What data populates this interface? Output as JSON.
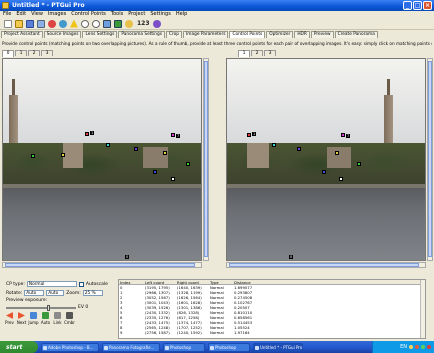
{
  "window": {
    "title": "Untitled * - PTGui Pro"
  },
  "menu": [
    "File",
    "Edit",
    "View",
    "Images",
    "Control Points",
    "Tools",
    "Project",
    "Settings",
    "Help"
  ],
  "toolbar": {
    "zoom_label": "123"
  },
  "tabs": [
    "Project Assistant",
    "Source Images",
    "Lens Settings",
    "Panorama Settings",
    "Crop",
    "Image Parameters",
    "Control Points",
    "Optimizer",
    "HDR",
    "Preview",
    "Create Panorama"
  ],
  "active_tab": "Control Points",
  "hint": "Provide control points (matching points on two overlapping pictures). As a rule of thumb, provide at least three control points for each pair of overlapping images. It's easy: simply click on matching points on both images.",
  "left_pane": {
    "tabs": [
      "0",
      "1",
      "2",
      "3"
    ],
    "active": "0"
  },
  "right_pane": {
    "tabs": [
      "1",
      "2",
      "3"
    ],
    "active": "1"
  },
  "controls": {
    "cp_type_label": "CP type:",
    "cp_type_value": "Normal",
    "autoscale_label": "Autoscale",
    "rotate_label": "Rotate:",
    "rotate_left": "Auto",
    "rotate_right": "Auto",
    "zoom_label": "Zoom:",
    "zoom_value": "25 %",
    "preview_exposure_label": "Preview exposure:",
    "exposure_value": "EV 0",
    "buttons": [
      "Prev",
      "Next",
      "Jump",
      "Auto",
      "Link",
      "Cmbr"
    ]
  },
  "table": {
    "headers": [
      "Index",
      "Left coord",
      "Right coord",
      "Type",
      "Distance"
    ],
    "rows": [
      [
        "0",
        "(3195, 1795)",
        "(1640, 1639)",
        "Normal",
        "1.699077"
      ],
      [
        "1",
        "(2966, 1307)",
        "(1328, 1199)",
        "Normal",
        "0.293807"
      ],
      [
        "2",
        "(3052, 1567)",
        "(1626, 1564)",
        "Normal",
        "0.274508"
      ],
      [
        "3",
        "(3001, 1043)",
        "(1601, 1628)",
        "Normal",
        "0.102767"
      ],
      [
        "4",
        "(3039, 1526)",
        "(1301, 1386)",
        "Normal",
        "0.20507"
      ],
      [
        "5",
        "(2430, 1332)",
        "(826, 1328)",
        "Normal",
        "0.810110"
      ],
      [
        "6",
        "(2335, 1276)",
        "(617, 1258)",
        "Normal",
        "0.658561"
      ],
      [
        "7",
        "(2433, 1475)",
        "(1374, 1477)",
        "Normal",
        "0.514453"
      ],
      [
        "8",
        "(2565, 1248)",
        "(1707, 1252)",
        "Normal",
        "1.05524"
      ],
      [
        "9",
        "(2756, 1587)",
        "(1240, 1592)",
        "Normal",
        "1.97164"
      ]
    ]
  },
  "taskbar": {
    "start": "start",
    "tasks": [
      "Adobe Photoshop - B...",
      "Panorama Fotografie...",
      "Photoshop",
      "Photoshop",
      "Untitled * - PTGui Pro"
    ],
    "active_task": "Untitled * - PTGui Pro",
    "tray_label": "EN"
  },
  "colors": {
    "titlebar": "#0a56d8",
    "taskbar": "#245ad0",
    "start": "#3c9a3c"
  }
}
